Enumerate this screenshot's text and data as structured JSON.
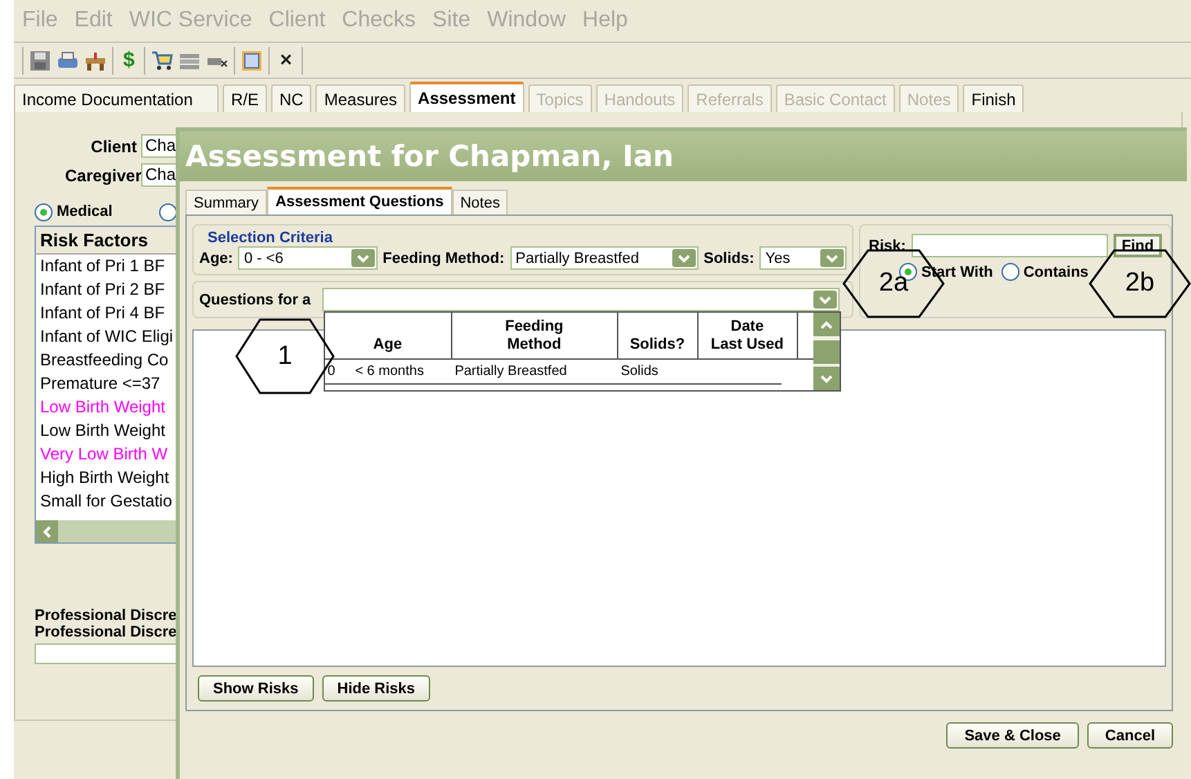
{
  "menu": [
    {
      "label": "File"
    },
    {
      "label": "Edit"
    },
    {
      "label": "WIC Service"
    },
    {
      "label": "Client"
    },
    {
      "label": "Checks"
    },
    {
      "label": "Site"
    },
    {
      "label": "Window"
    },
    {
      "label": "Help"
    }
  ],
  "toolbar": [
    {
      "kind": "icon"
    },
    {
      "kind": "icon"
    },
    {
      "kind": "icon"
    },
    {
      "kind": "glyph",
      "text": "$"
    },
    {
      "kind": "icon"
    },
    {
      "kind": "icon"
    },
    {
      "kind": "icon"
    },
    {
      "kind": "icon"
    },
    {
      "kind": "glyph",
      "text": "×"
    }
  ],
  "tabs": [
    {
      "label": "Income Documentation",
      "selected": false,
      "disabled": false
    },
    {
      "label": "R/E",
      "selected": false,
      "disabled": false
    },
    {
      "label": "NC",
      "selected": false,
      "disabled": false
    },
    {
      "label": "Measures",
      "selected": false,
      "disabled": false
    },
    {
      "label": "Assessment",
      "selected": true,
      "disabled": false
    },
    {
      "label": "Topics",
      "selected": false,
      "disabled": true
    },
    {
      "label": "Handouts",
      "selected": false,
      "disabled": true
    },
    {
      "label": "Referrals",
      "selected": false,
      "disabled": true
    },
    {
      "label": "Basic Contact",
      "selected": false,
      "disabled": true
    },
    {
      "label": "Notes",
      "selected": false,
      "disabled": true
    },
    {
      "label": "Finish",
      "selected": false,
      "disabled": false
    }
  ],
  "client": {
    "label": "Client",
    "value": "Cha"
  },
  "caregiver": {
    "label": "Caregiver",
    "value": "Cha"
  },
  "risk_type": [
    {
      "label": "Medical",
      "selected": true
    },
    {
      "selected": false
    }
  ],
  "risk_factors": {
    "header": "Risk Factors",
    "items": [
      {
        "label": "Infant of Pri 1 BF",
        "color": "#000000"
      },
      {
        "label": "Infant of Pri 2 BF",
        "color": "#000000"
      },
      {
        "label": "Infant of Pri 4 BF",
        "color": "#000000"
      },
      {
        "label": "Infant of WIC Eligi",
        "color": "#000000"
      },
      {
        "label": "Breastfeeding Co",
        "color": "#000000"
      },
      {
        "label": "Premature <=37",
        "color": "#000000"
      },
      {
        "label": "Low Birth Weight",
        "color": "#ff00ff"
      },
      {
        "label": "Low Birth Weight",
        "color": "#000000"
      },
      {
        "label": "Very Low Birth W",
        "color": "#ff00ff"
      },
      {
        "label": "High Birth Weight",
        "color": "#000000"
      },
      {
        "label": "Small for Gestatio",
        "color": "#000000"
      }
    ]
  },
  "professional_discretion": [
    "Professional Discre",
    "Professional Discre"
  ],
  "dialog": {
    "title": "Assessment for Chapman, Ian",
    "tabs": [
      {
        "label": "Summary",
        "selected": false
      },
      {
        "label": "Assessment Questions",
        "selected": true
      },
      {
        "label": "Notes",
        "selected": false
      }
    ],
    "selection_criteria": {
      "title": "Selection Criteria",
      "age": {
        "label": "Age:",
        "value": "0 - <6"
      },
      "feeding_method": {
        "label": "Feeding Method:",
        "value": "Partially Breastfed"
      },
      "solids": {
        "label": "Solids:",
        "value": "Yes"
      }
    },
    "questions": {
      "label": "Questions for a",
      "dropdown": {
        "columns": [
          "Age",
          "Feeding\nMethod",
          "Solids?",
          "Date\nLast Used"
        ],
        "rows": [
          {
            "number": "0",
            "cells": [
              "< 6 months",
              "Partially Breastfed",
              "Solids"
            ]
          }
        ]
      }
    },
    "risk_search": {
      "label": "Risk:",
      "button": "Find",
      "options": [
        {
          "label": "Start With",
          "selected": true
        },
        {
          "label": "Contains",
          "selected": false
        }
      ]
    },
    "list_buttons": [
      "Show Risks",
      "Hide Risks"
    ],
    "footer_buttons": [
      "Save & Close",
      "Cancel"
    ]
  },
  "callouts": [
    "1",
    "2a",
    "2b"
  ]
}
